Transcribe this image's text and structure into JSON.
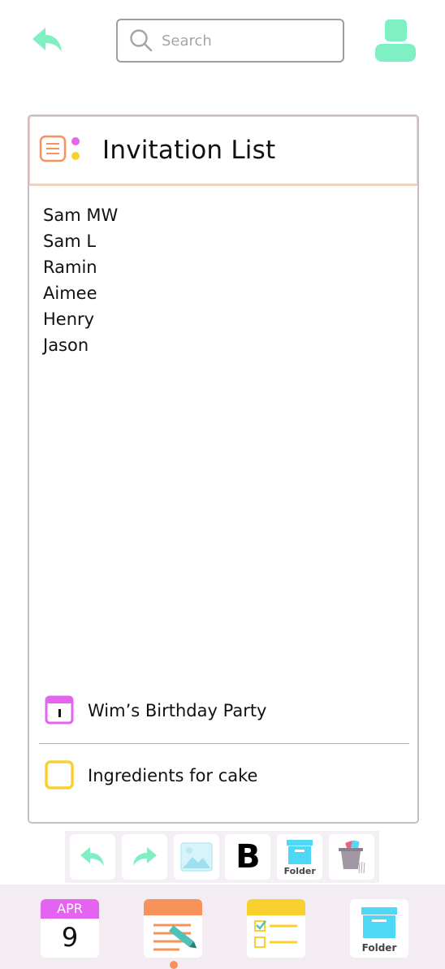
{
  "header": {
    "search_placeholder": "Search"
  },
  "note": {
    "title": "Invitation List",
    "names": [
      "Sam MW",
      "Sam L",
      "Ramin",
      "Aimee",
      "Henry",
      "Jason"
    ],
    "attachments": {
      "event_label": "Wim’s Birthday Party",
      "list_label": "Ingredients for cake"
    }
  },
  "toolbar": {
    "bold_label": "B",
    "folder_label": "Folder"
  },
  "bottom_nav": {
    "calendar_month": "APR",
    "calendar_day": "9",
    "folder_label": "Folder"
  },
  "colors": {
    "accent_green": "#7ef0c4",
    "accent_orange": "#f7935a",
    "accent_pink": "#e463f0",
    "accent_yellow": "#f8d12f",
    "accent_cyan": "#4fd8f6"
  }
}
